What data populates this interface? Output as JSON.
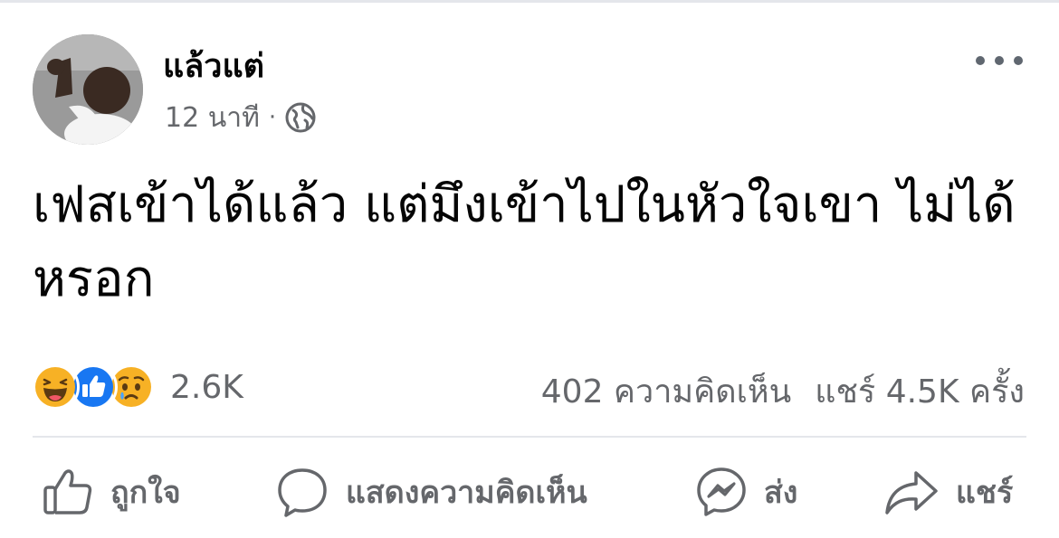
{
  "post": {
    "author": "แล้วแต่",
    "time": "12 นาที",
    "separator": "·",
    "audience_icon": "globe-icon",
    "text": "เฟสเข้าได้แล้ว แต่มึงเข้าไปในหัวใจเขา ไม่ได้หรอก"
  },
  "reactions": {
    "icons": [
      "haha-icon",
      "like-icon",
      "sad-icon"
    ],
    "count": "2.6K"
  },
  "stats": {
    "comments": "402 ความคิดเห็น",
    "shares": "แชร์ 4.5K ครั้ง"
  },
  "actions": {
    "like": "ถูกใจ",
    "comment": "แสดงความคิดเห็น",
    "send": "ส่ง",
    "share": "แชร์"
  },
  "colors": {
    "secondary_text": "#65676b",
    "like_blue": "#1877f2",
    "reaction_yellow": "#f7b125"
  }
}
